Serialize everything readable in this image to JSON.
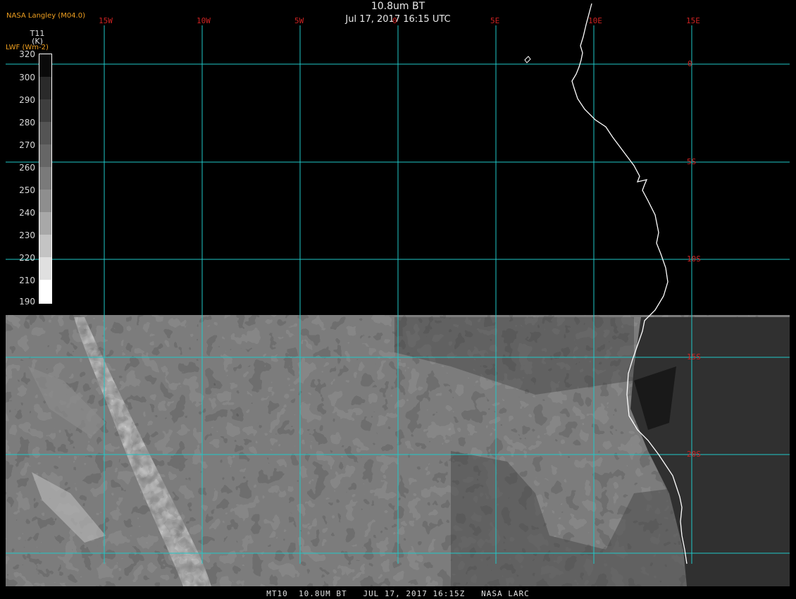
{
  "header": {
    "title": "10.8um BT",
    "subtitle": "Jul 17, 2017 16:15 UTC",
    "org": "NASA Langley (M04.0)"
  },
  "colorbar": {
    "title": "T11\n(K)",
    "subtitle": "LWF (Wm-2)",
    "ticks": [
      "320",
      "300",
      "290",
      "280",
      "270",
      "260",
      "250",
      "240",
      "230",
      "220",
      "210",
      "190"
    ],
    "unit_min_K": 190,
    "unit_max_K": 320
  },
  "map": {
    "lon_labels": [
      "15W",
      "10W",
      "5W",
      "0",
      "5E",
      "10E",
      "15E"
    ],
    "lat_labels": [
      "0",
      "5S",
      "10S",
      "15S",
      "20S"
    ],
    "grid_color": "#20c8c8",
    "label_color": "#cc2222",
    "coast_color": "#ffffff"
  },
  "footer": {
    "text": "MT10  10.8UM BT   JUL 17, 2017 16:15Z   NASA LARC"
  }
}
